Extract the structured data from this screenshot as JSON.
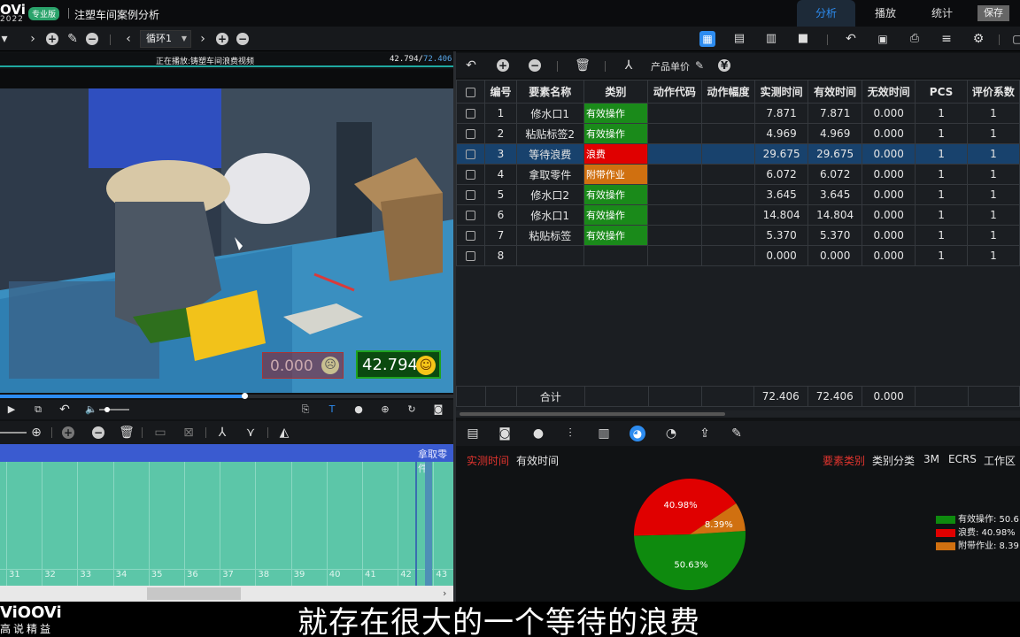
{
  "app": {
    "logo": "OVi",
    "year": "2022",
    "badge": "专业版",
    "title": "注塑车间案例分析",
    "nav": [
      "分析",
      "播放",
      "统计"
    ],
    "save": "保存"
  },
  "toolbar": {
    "loop_select": "循环1"
  },
  "video": {
    "title": "正在播放:铸塑车间浪费视频",
    "time_current": "42.794/",
    "time_total": "72.406",
    "progress": 0.54,
    "overlay_left": "0.000",
    "overlay_right": "42.794"
  },
  "timeline": {
    "bar_label": "拿取零件",
    "ticks": [
      "31",
      "32",
      "33",
      "34",
      "35",
      "36",
      "37",
      "38",
      "39",
      "40",
      "41",
      "42",
      "43"
    ]
  },
  "right_toolbar": {
    "price_label": "产品单价"
  },
  "table": {
    "headers": [
      "编号",
      "要素名称",
      "类别",
      "动作代码",
      "动作幅度",
      "实测时间",
      "有效时间",
      "无效时间",
      "PCS",
      "评价系数"
    ],
    "rows": [
      {
        "no": "1",
        "name": "修水口1",
        "cat": "有效操作",
        "catColor": "#1a8a1a",
        "measured": "7.871",
        "effective": "7.871",
        "invalid": "0.000",
        "pcs": "1",
        "coef": "1"
      },
      {
        "no": "2",
        "name": "粘贴标签2",
        "cat": "有效操作",
        "catColor": "#1a8a1a",
        "measured": "4.969",
        "effective": "4.969",
        "invalid": "0.000",
        "pcs": "1",
        "coef": "1"
      },
      {
        "no": "3",
        "name": "等待浪费",
        "cat": "浪费",
        "catColor": "#e00000",
        "measured": "29.675",
        "effective": "29.675",
        "invalid": "0.000",
        "pcs": "1",
        "coef": "1",
        "selected": true
      },
      {
        "no": "4",
        "name": "拿取零件",
        "cat": "附带作业",
        "catColor": "#d07010",
        "measured": "6.072",
        "effective": "6.072",
        "invalid": "0.000",
        "pcs": "1",
        "coef": "1"
      },
      {
        "no": "5",
        "name": "修水口2",
        "cat": "有效操作",
        "catColor": "#1a8a1a",
        "measured": "3.645",
        "effective": "3.645",
        "invalid": "0.000",
        "pcs": "1",
        "coef": "1"
      },
      {
        "no": "6",
        "name": "修水口1",
        "cat": "有效操作",
        "catColor": "#1a8a1a",
        "measured": "14.804",
        "effective": "14.804",
        "invalid": "0.000",
        "pcs": "1",
        "coef": "1"
      },
      {
        "no": "7",
        "name": "粘贴标签",
        "cat": "有效操作",
        "catColor": "#1a8a1a",
        "measured": "5.370",
        "effective": "5.370",
        "invalid": "0.000",
        "pcs": "1",
        "coef": "1"
      },
      {
        "no": "8",
        "name": "",
        "cat": "",
        "catColor": "",
        "measured": "0.000",
        "effective": "0.000",
        "invalid": "0.000",
        "pcs": "1",
        "coef": "1"
      }
    ],
    "footer": {
      "label": "合计",
      "measured": "72.406",
      "effective": "72.406",
      "invalid": "0.000"
    }
  },
  "analysis": {
    "left_tabs": [
      "实测时间",
      "有效时间"
    ],
    "right_tabs": [
      "要素类别",
      "类别分类",
      "3M",
      "ECRS",
      "工作区"
    ]
  },
  "chart_data": {
    "type": "pie",
    "slices": [
      {
        "label": "有效操作",
        "value": 50.63,
        "color": "#0e8a0e",
        "text": "50.63%"
      },
      {
        "label": "浪费",
        "value": 40.98,
        "color": "#e00000",
        "text": "40.98%"
      },
      {
        "label": "附带作业",
        "value": 8.39,
        "color": "#d07010",
        "text": "8.39%"
      }
    ],
    "legend": [
      "有效操作: 50.6",
      "浪费: 40.98%",
      "附带作业: 8.39"
    ]
  },
  "brand": {
    "name": "ViOOVi",
    "sub": "高说精益"
  },
  "subtitle": "就存在很大的一个等待的浪费"
}
